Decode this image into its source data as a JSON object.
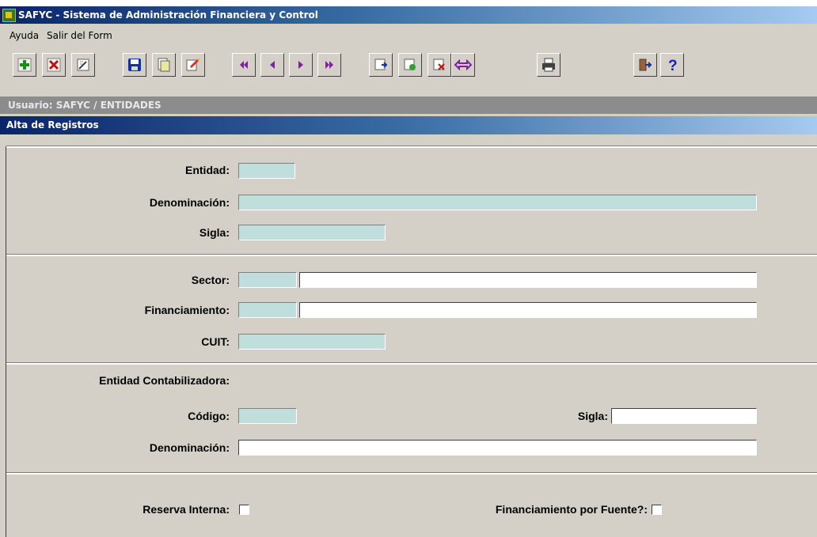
{
  "window": {
    "title": "SAFYC - Sistema de Administración Financiera y Control"
  },
  "menu": {
    "items": [
      "Ayuda",
      "Salir del Form"
    ]
  },
  "toolbar": {
    "icons": [
      "add-record-icon",
      "delete-record-icon",
      "clear-icon",
      "save-icon",
      "copy-icon",
      "edit-icon",
      "first-record-icon",
      "previous-record-icon",
      "next-record-icon",
      "last-record-icon",
      "enter-query-icon",
      "execute-query-icon",
      "cancel-query-icon",
      "toggle-icon",
      "print-icon",
      "exit-icon",
      "help-icon"
    ]
  },
  "userbar": {
    "text": "Usuario: SAFYC  /  ENTIDADES"
  },
  "form": {
    "title": "Alta de Registros"
  },
  "section1": {
    "entidad": {
      "label": "Entidad:",
      "value": ""
    },
    "denominacion": {
      "label": "Denominación:",
      "value": ""
    },
    "sigla": {
      "label": "Sigla:",
      "value": ""
    }
  },
  "section2": {
    "sector": {
      "label": "Sector:",
      "code": "",
      "desc": ""
    },
    "financiamiento": {
      "label": "Financiamiento:",
      "code": "",
      "desc": ""
    },
    "cuit": {
      "label": "CUIT:",
      "value": ""
    }
  },
  "section3": {
    "heading": "Entidad Contabilizadora:",
    "codigo": {
      "label": "Código:",
      "value": ""
    },
    "sigla": {
      "label": "Sigla:",
      "value": ""
    },
    "denominacion": {
      "label": "Denominación:",
      "value": ""
    }
  },
  "section4": {
    "reserva": {
      "label": "Reserva Interna:",
      "checked": false
    },
    "financiamiento_fuente": {
      "label": "Financiamiento por Fuente?:",
      "checked": false
    }
  },
  "colors": {
    "field_bg": "#bfdedc",
    "title_bar": "#0a246a",
    "window_bg": "#d4d0c8"
  }
}
